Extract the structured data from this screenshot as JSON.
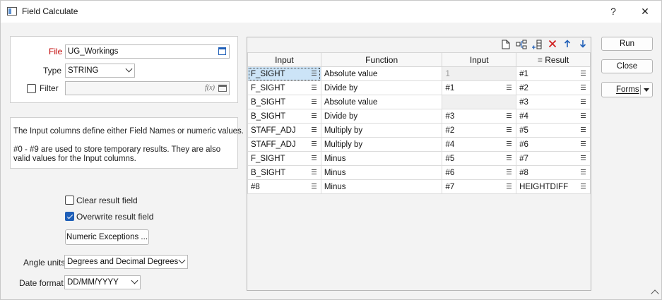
{
  "window": {
    "title": "Field Calculate",
    "help_glyph": "?",
    "close_glyph": "✕"
  },
  "file_panel": {
    "file_label": "File",
    "file_value": "UG_Workings",
    "type_label": "Type",
    "type_value": "STRING",
    "filter_label": "Filter",
    "filter_checked": false,
    "filter_value": "",
    "fx_glyph": "f(x)"
  },
  "info": {
    "line1": "The Input columns define either Field Names or numeric values.",
    "line2": "#0 - #9 are used to store temporary results.  They are also",
    "line3": "valid values for the Input columns."
  },
  "options": {
    "clear_label": "Clear result field",
    "clear_checked": false,
    "overwrite_label": "Overwrite result field",
    "overwrite_checked": true,
    "numeric_exceptions_label": "Numeric Exceptions ...",
    "angle_units_label": "Angle units",
    "angle_units_value": "Degrees and Decimal Degrees",
    "date_format_label": "Date format",
    "date_format_value": "DD/MM/YYYY"
  },
  "grid": {
    "toolbar_icons": [
      "new-file-icon",
      "insert-row-icon",
      "append-row-icon",
      "delete-icon",
      "move-up-icon",
      "move-down-icon"
    ],
    "headers": [
      "Input",
      "Function",
      "Input",
      "=  Result"
    ],
    "rows": [
      {
        "input1": "F_SIGHT",
        "function": "Absolute value",
        "input2": "1",
        "result": "#1"
      },
      {
        "input1": "F_SIGHT",
        "function": "Divide by",
        "input2": "#1",
        "result": "#2"
      },
      {
        "input1": "B_SIGHT",
        "function": "Absolute value",
        "input2": "",
        "result": "#3"
      },
      {
        "input1": "B_SIGHT",
        "function": "Divide by",
        "input2": "#3",
        "result": "#4"
      },
      {
        "input1": "STAFF_ADJ",
        "function": "Multiply by",
        "input2": "#2",
        "result": "#5"
      },
      {
        "input1": "STAFF_ADJ",
        "function": "Multiply by",
        "input2": "#4",
        "result": "#6"
      },
      {
        "input1": "F_SIGHT",
        "function": "Minus",
        "input2": "#5",
        "result": "#7"
      },
      {
        "input1": "B_SIGHT",
        "function": "Minus",
        "input2": "#6",
        "result": "#8"
      },
      {
        "input1": "#8",
        "function": "Minus",
        "input2": "#7",
        "result": "HEIGHTDIFF"
      }
    ]
  },
  "side_buttons": {
    "run": "Run",
    "close": "Close",
    "forms": "Forms"
  },
  "colors": {
    "accent": "#1f5fb8",
    "delete": "#d02020",
    "arrows": "#1f5fb8",
    "selected_cell": "#cce4f7"
  }
}
